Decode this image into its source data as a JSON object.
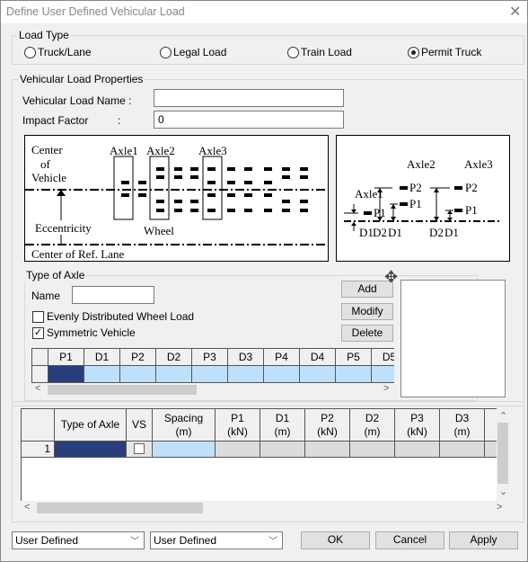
{
  "window": {
    "title": "Define User Defined Vehicular Load",
    "close_icon": "close-icon"
  },
  "load_type": {
    "label": "Load Type",
    "options": [
      "Truck/Lane",
      "Legal Load",
      "Train Load",
      "Permit Truck"
    ],
    "selected": "Permit Truck"
  },
  "properties": {
    "label": "Vehicular Load Properties",
    "name_label": "Vehicular Load Name :",
    "name_value": "",
    "impact_label": "Impact Factor",
    "impact_colon": ":",
    "impact_value": "0"
  },
  "diagram_plan": {
    "center_1": "Center",
    "center_2": "of",
    "center_3": "Vehicle",
    "axle1": "Axle1",
    "axle2": "Axle2",
    "axle3": "Axle3",
    "eccentricity": "Eccentricity",
    "wheel": "Wheel",
    "ref_lane": "Center of Ref. Lane"
  },
  "diagram_elev": {
    "axle1": "Axle1",
    "axle2": "Axle2",
    "axle3": "Axle3",
    "p1": "P1",
    "p2": "P2",
    "d1": "D1",
    "d2": "D2"
  },
  "axle": {
    "label": "Type of Axle",
    "name_label": "Name",
    "name_value": "",
    "evenly_label": "Evenly Distributed Wheel Load",
    "evenly_checked": false,
    "symmetric_label": "Symmetric Vehicle",
    "symmetric_checked": true,
    "add": "Add",
    "modify": "Modify",
    "delete": "Delete",
    "columns": [
      "P1",
      "D1",
      "P2",
      "D2",
      "P3",
      "D3",
      "P4",
      "D4",
      "P5",
      "D5"
    ]
  },
  "main_grid": {
    "columns": [
      {
        "l1": "Type of Axle",
        "l2": ""
      },
      {
        "l1": "VS",
        "l2": ""
      },
      {
        "l1": "Spacing",
        "l2": "(m)"
      },
      {
        "l1": "P1",
        "l2": "(kN)"
      },
      {
        "l1": "D1",
        "l2": "(m)"
      },
      {
        "l1": "P2",
        "l2": "(kN)"
      },
      {
        "l1": "D2",
        "l2": "(m)"
      },
      {
        "l1": "P3",
        "l2": "(kN)"
      },
      {
        "l1": "D3",
        "l2": "(m)"
      },
      {
        "l1": "",
        "l2": ""
      }
    ],
    "rows": [
      {
        "num": "1",
        "vs_checked": false
      }
    ]
  },
  "footer": {
    "dropdown1": "User Defined",
    "dropdown2": "User Defined",
    "ok": "OK",
    "cancel": "Cancel",
    "apply": "Apply"
  },
  "colors": {
    "selected_cell": "#2b3e7c",
    "editable_cell": "#bfe0fa",
    "readonly_cell": "#dcdcdc"
  }
}
